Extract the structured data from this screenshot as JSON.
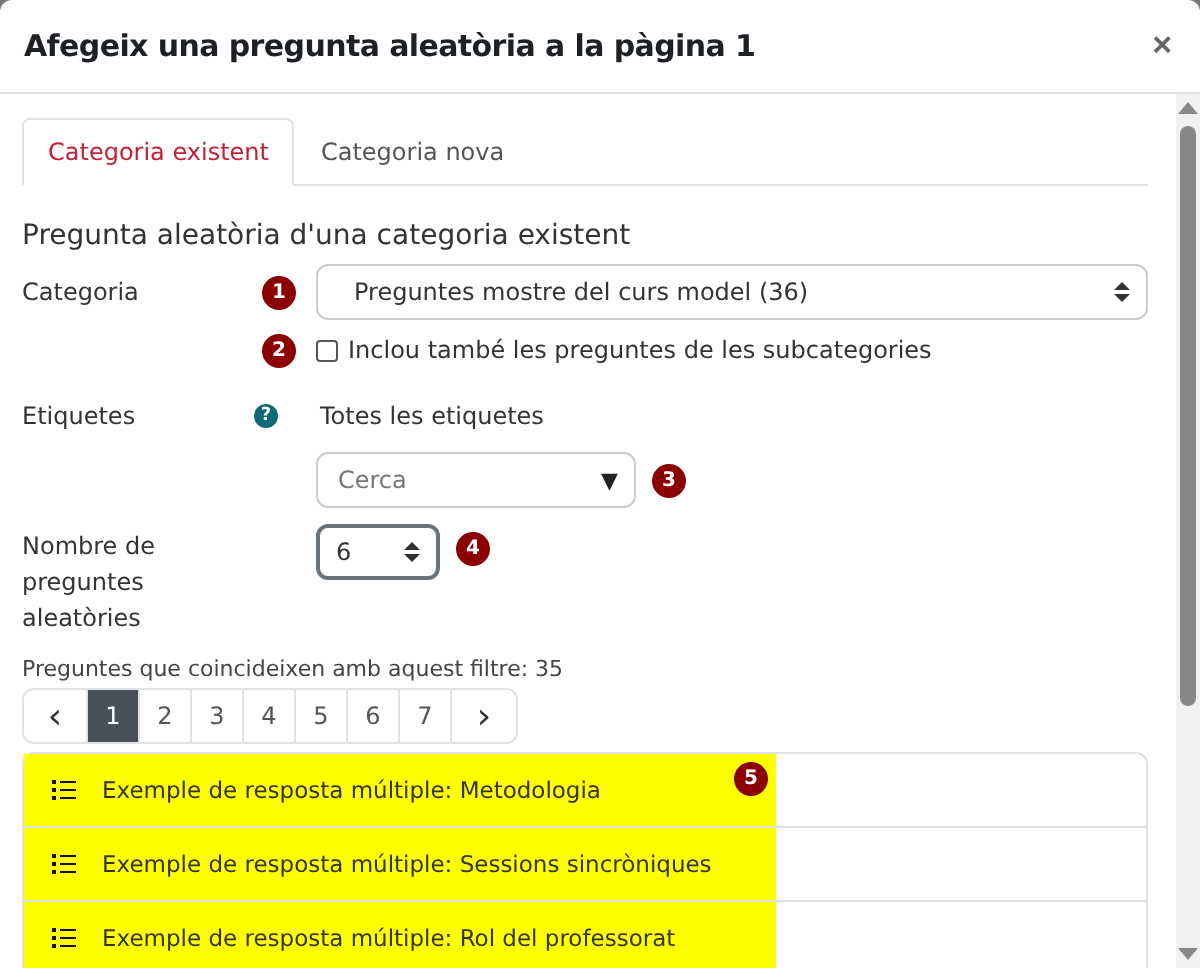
{
  "window": {
    "title": "Afegeix una pregunta aleatòria a la pàgina 1",
    "close": "×"
  },
  "tabs": [
    {
      "label": "Categoria existent",
      "selected": true
    },
    {
      "label": "Categoria nova",
      "selected": false
    }
  ],
  "heading": "Pregunta aleatòria d'una categoria existent",
  "category": {
    "label": "Categoria",
    "marker": "1",
    "value": "Preguntes mostre del curs model (36)"
  },
  "subcategories": {
    "marker": "2",
    "label": "Inclou també les preguntes de les subcategories",
    "checked": false
  },
  "tags": {
    "label": "Etiquetes",
    "help": "?",
    "value": "Totes les etiquetes",
    "search_placeholder": "Cerca",
    "caret": "▼",
    "marker": "3"
  },
  "count": {
    "label": "Nombre de preguntes aleatòries",
    "value": "6",
    "marker": "4"
  },
  "filter_text": "Preguntes que coincideixen amb aquest filtre: 35",
  "pages": [
    {
      "label": "‹",
      "selected": false
    },
    {
      "label": "1",
      "selected": true
    },
    {
      "label": "2",
      "selected": false
    },
    {
      "label": "3",
      "selected": false
    },
    {
      "label": "4",
      "selected": false
    },
    {
      "label": "5",
      "selected": false
    },
    {
      "label": "6",
      "selected": false
    },
    {
      "label": "7",
      "selected": false
    },
    {
      "label": "›",
      "selected": false
    }
  ],
  "list_marker": "5",
  "questions": [
    {
      "text": "Exemple de resposta múltiple: Metodologia",
      "highlighted": true
    },
    {
      "text": "Exemple de resposta múltiple: Sessions sincròniques",
      "highlighted": true
    },
    {
      "text": "Exemple de resposta múltiple: Rol del professorat",
      "highlighted": true
    }
  ]
}
